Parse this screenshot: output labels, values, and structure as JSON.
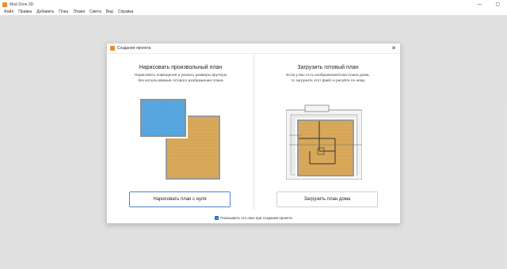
{
  "app": {
    "title": "Mod Zone 3D",
    "menu": [
      "Файл",
      "Правка",
      "Добавить",
      "План",
      "Этажи",
      "Смета",
      "Вид",
      "Справка"
    ],
    "window_controls": [
      "—",
      "▢"
    ]
  },
  "dialog": {
    "title": "Создание проекта",
    "close": "✕",
    "left": {
      "heading": "Нарисовать произвольный план",
      "description_line1": "Нарисовать помещения и указать размеры вручную",
      "description_line2": "без использования готового изображения плана",
      "button": "Нарисовать план с нуля"
    },
    "right": {
      "heading": "Загрузить готовый план",
      "description_line1": "Если у вас есть изображение/скан плана дома,",
      "description_line2": "то загрузите этот файл и рисуйте по нему",
      "button": "Загрузить план дома"
    },
    "footer": {
      "checkbox_checked": true,
      "checkbox_mark": "✓",
      "checkbox_label": "Показывать это окно при создании проекта"
    }
  },
  "colors": {
    "accent": "#f08a24",
    "floor_wood": "#d9a85a",
    "floor_tile": "#5aa8e0",
    "button_border_active": "#4a86c8",
    "checkbox": "#1f6fbf"
  }
}
